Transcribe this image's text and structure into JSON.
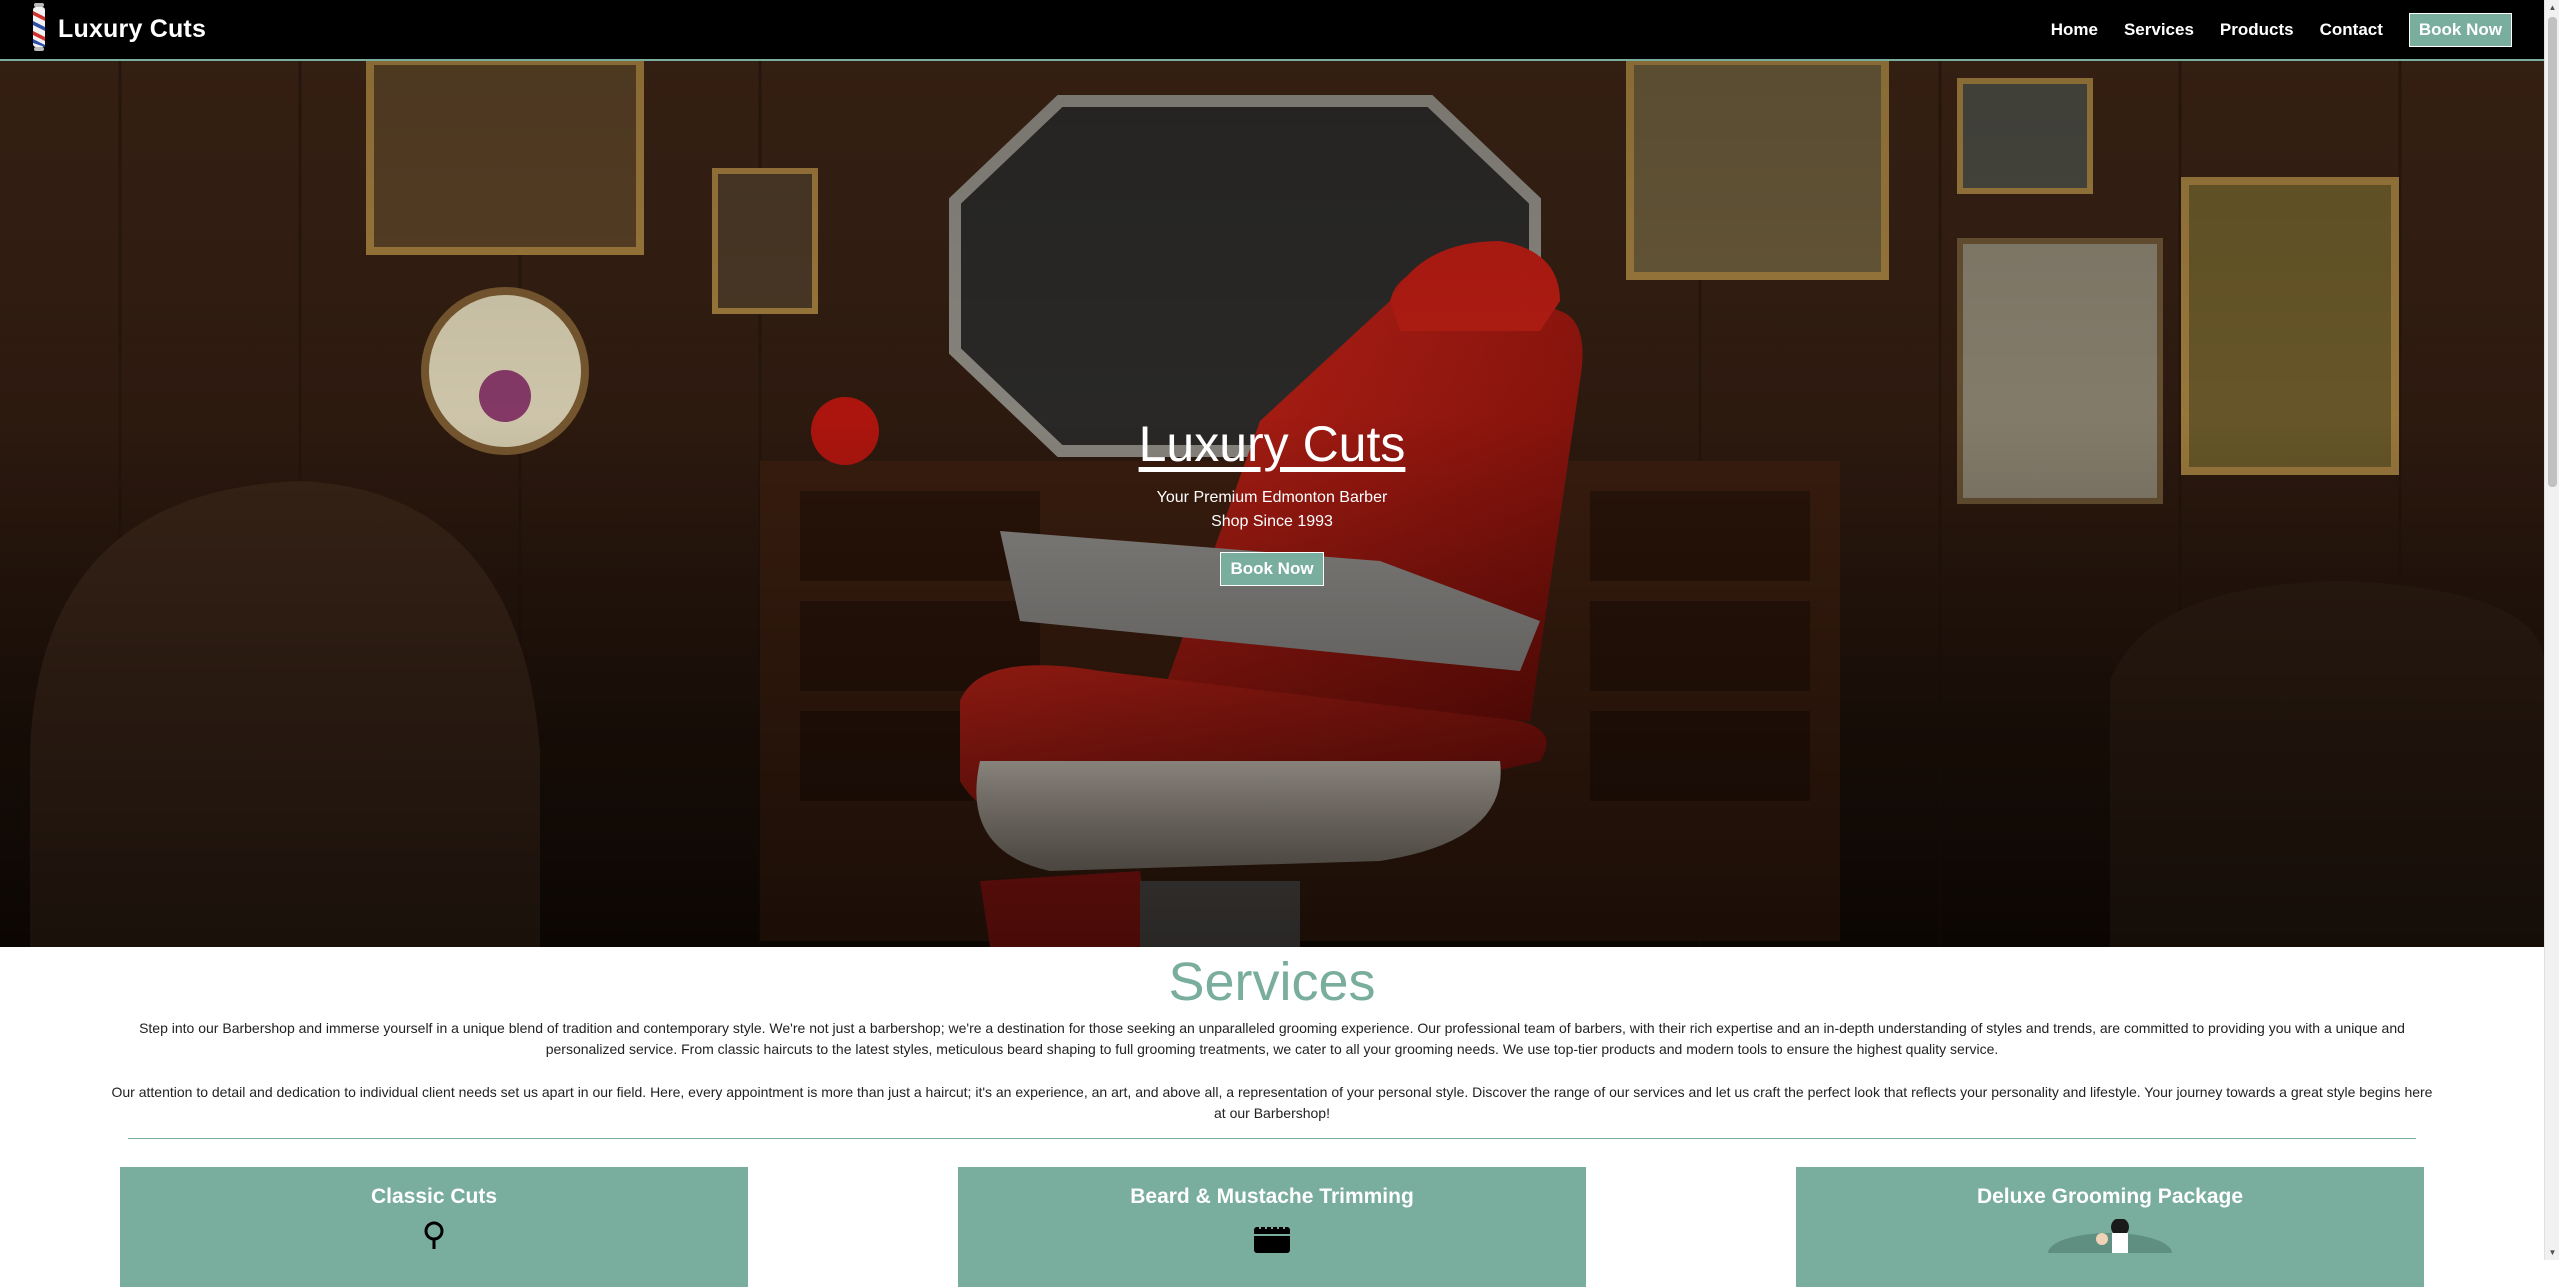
{
  "nav": {
    "brand": "Luxury Cuts",
    "links": [
      "Home",
      "Services",
      "Products",
      "Contact"
    ],
    "book_label": "Book Now"
  },
  "hero": {
    "title": "Luxury Cuts",
    "subtitle": "Your Premium Edmonton Barber Shop Since 1993",
    "book_label": "Book Now"
  },
  "services": {
    "title": "Services",
    "paragraphs": [
      "Step into our Barbershop and immerse yourself in a unique blend of tradition and contemporary style. We're not just a barbershop; we're a destination for those seeking an unparalleled grooming experience. Our professional team of barbers, with their rich expertise and an in-depth understanding of styles and trends, are committed to providing you with a unique and personalized service. From classic haircuts to the latest styles, meticulous beard shaping to full grooming treatments, we cater to all your grooming needs. We use top-tier products and modern tools to ensure the highest quality service.",
      "Our attention to detail and dedication to individual client needs set us apart in our field. Here, every appointment is more than just a haircut; it's an experience, an art, and above all, a representation of your personal style. Discover the range of our services and let us craft the perfect look that reflects your personality and lifestyle. Your journey towards a great style begins here at our Barbershop!"
    ],
    "cards": [
      {
        "title": "Classic Cuts",
        "icon": "scissors-icon"
      },
      {
        "title": "Beard & Mustache Trimming",
        "icon": "trimmer-icon"
      },
      {
        "title": "Deluxe Grooming Package",
        "icon": "barber-illustration-icon"
      }
    ]
  },
  "colors": {
    "accent": "#79ad9d",
    "navbar": "#000000",
    "text": "#222222"
  }
}
